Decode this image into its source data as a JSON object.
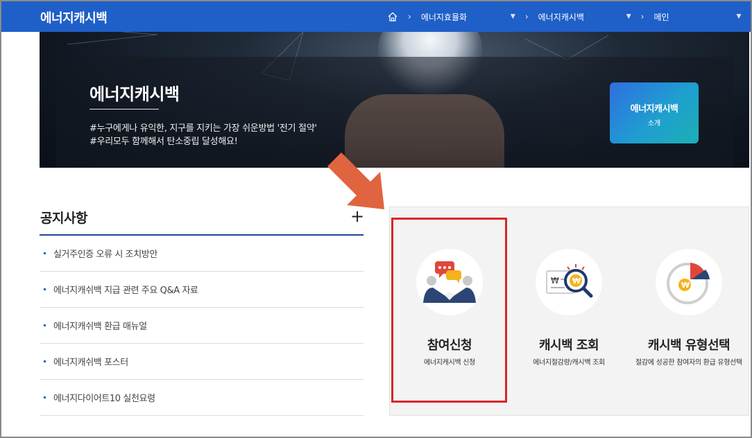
{
  "header": {
    "brand": "에너지캐시백",
    "breadcrumb": [
      {
        "label": "에너지효율화"
      },
      {
        "label": "에너지캐시백"
      },
      {
        "label": "메인"
      }
    ]
  },
  "hero": {
    "title": "에너지캐시백",
    "desc1": "#누구에게나 유익한, 지구를 지키는 가장 쉬운방법 '전기 절약'",
    "desc2": "#우리모두 함께해서 탄소중립 달성해요!",
    "intro_button": {
      "line1": "에너지캐시백",
      "line2": "소개"
    }
  },
  "notice": {
    "title": "공지사항",
    "more": "+",
    "items": [
      "실거주인증 오류 시 조치방안",
      "에너지캐쉬백 지급 관련 주요 Q&A 자료",
      "에너지캐쉬백 환급 매뉴얼",
      "에너지캐쉬백 포스터",
      "에너지다이어트10 실천요령"
    ]
  },
  "services": [
    {
      "name": "참여신청",
      "sub": "에너지캐시백 신청",
      "icon": "people-chat-icon"
    },
    {
      "name": "캐시백 조회",
      "sub": "에너지절감량/캐시백 조회",
      "icon": "won-magnifier-icon"
    },
    {
      "name": "캐시백 유형선택",
      "sub": "절감에 성공한 참여자의 환급 유형선택",
      "icon": "pie-won-icon"
    }
  ],
  "colors": {
    "topbar": "#1f5fc8",
    "accent_rule": "#23449a",
    "highlight": "#d8262b",
    "arrow": "#e0643f"
  }
}
